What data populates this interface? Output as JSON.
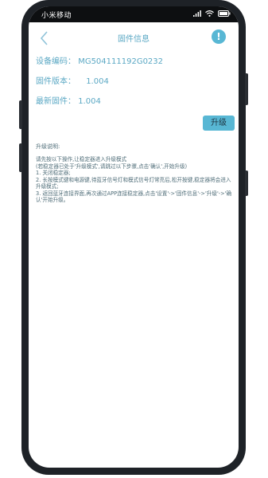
{
  "status_bar": {
    "carrier": "小米移动"
  },
  "header": {
    "title": "固件信息",
    "info_icon": "!"
  },
  "fields": {
    "device_code": {
      "label": "设备编码：",
      "value": "MG504111192G0232"
    },
    "firmware_version": {
      "label": "固件版本：",
      "value": "1.004"
    },
    "latest_firmware": {
      "label": "最新固件：",
      "value": "1.004"
    }
  },
  "actions": {
    "upgrade_label": "升级"
  },
  "instructions": {
    "title": "升级说明:",
    "lines": [
      "请先按以下操作,让稳定器进入升级模式",
      "(若稳定器已处于'升级模式',请跳过以下步骤,点击'确认',开始升级)",
      "1. 关闭稳定器;",
      "2. 长按模式键和电源键,待蓝牙信号灯和模式信号灯常亮后,松开按键,稳定器将会进入升级模式;",
      "3. 返回蓝牙连接界面,再次通过APP连接稳定器,点击'设置'->'固件信息'->'升级'->'确认'开始升级。"
    ]
  },
  "colors": {
    "accent": "#58b7d4",
    "text_primary": "#5ba8c4",
    "text_secondary": "#4f6d78"
  }
}
